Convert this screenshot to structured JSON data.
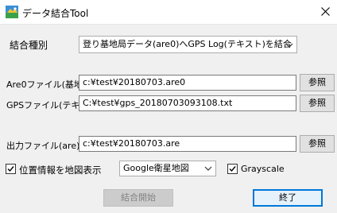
{
  "window": {
    "title": "データ結合Tool",
    "icon": "app-icon",
    "close_glyph": "✕"
  },
  "merge_type": {
    "label": "結合種別",
    "selected": "登り基地局データ(are0)へGPS Log(テキスト)を結合"
  },
  "are0_file": {
    "label": "Are0ファイル(基地)",
    "value": "c:¥test¥20180703.are0",
    "browse": "参照"
  },
  "gps_file": {
    "label": "GPSファイル(テキスト)",
    "value": "C:¥test¥gps_20180703093108.txt",
    "browse": "参照"
  },
  "output_file": {
    "label": "出力ファイル(are)",
    "value": "c:¥test¥20180703.are",
    "browse": "参照"
  },
  "map_display": {
    "label": "位置情報を地図表示",
    "checked": true,
    "map_type": "Google衛星地図"
  },
  "grayscale": {
    "label": "Grayscale",
    "checked": true
  },
  "buttons": {
    "start": "結合開始",
    "end": "終了"
  },
  "colors": {
    "accent": "#0078d7",
    "disabled_text": "#838383",
    "window_bg": "#f0f0f0"
  }
}
